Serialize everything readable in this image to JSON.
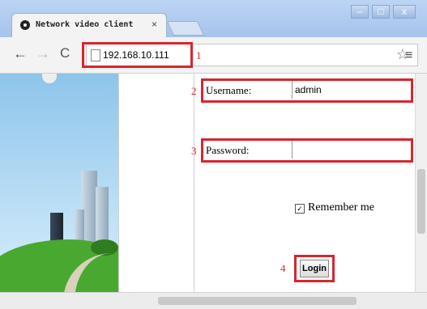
{
  "tab": {
    "title": "Network video client",
    "close": "×"
  },
  "window_controls": {
    "minimize": "–",
    "maximize": "□",
    "close": "x"
  },
  "nav": {
    "back": "←",
    "forward": "→",
    "reload": "C"
  },
  "address_bar": {
    "url": "192.168.10.111",
    "star": "☆",
    "menu": "≡"
  },
  "callouts": [
    "1",
    "2",
    "3",
    "4"
  ],
  "login_form": {
    "username_label": "Username:",
    "username_value": "admin",
    "password_label": "Password:",
    "password_value": "",
    "remember_label": "Remember me",
    "remember_checked": true,
    "login_button": "Login"
  },
  "colors": {
    "callout_red": "#d7262e",
    "titlebar_blue": "#a7c3ec"
  }
}
